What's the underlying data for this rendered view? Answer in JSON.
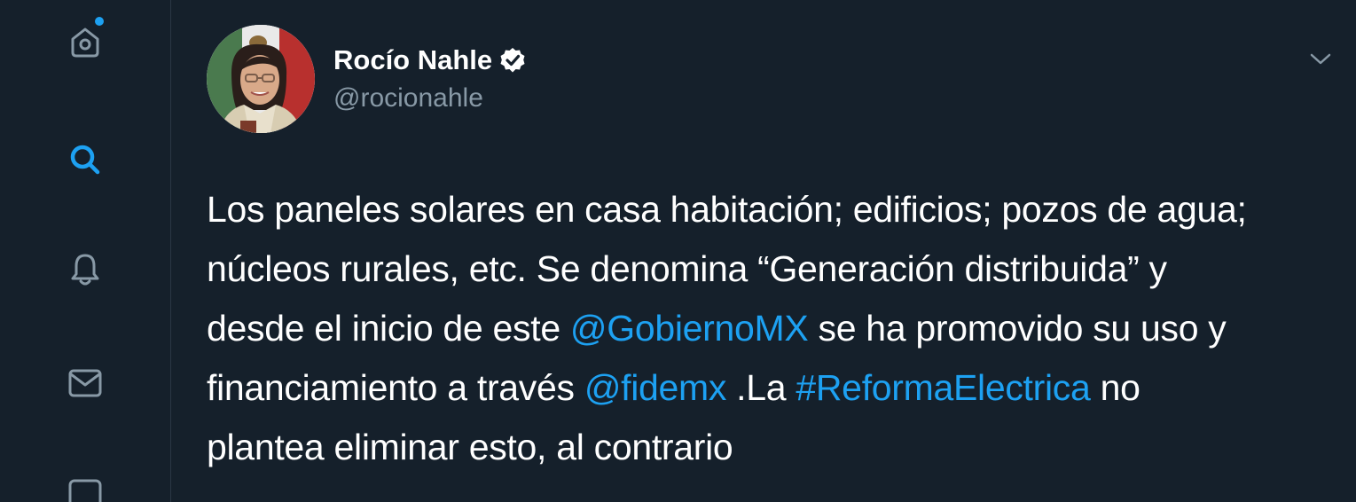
{
  "sidebar": {
    "items": [
      {
        "icon": "home-icon",
        "has_notification_dot": true
      },
      {
        "icon": "search-icon",
        "active": true
      },
      {
        "icon": "bell-icon"
      },
      {
        "icon": "mail-icon"
      },
      {
        "icon": "bookmark-icon"
      }
    ]
  },
  "tweet": {
    "author": {
      "display_name": "Rocío Nahle",
      "handle": "@rocionahle",
      "verified": true
    },
    "text": {
      "l1": "Los paneles solares en casa habitación; edificios; pozos de agua;",
      "l2": "núcleos rurales, etc. Se denomina “Generación distribuida” y",
      "l3_a": "desde el inicio de este ",
      "l3_mention": "@GobiernoMX",
      "l3_b": " se ha promovido su uso y",
      "l4_a": "financiamiento a través ",
      "l4_mention": "@fidemx",
      "l4_b": " .La ",
      "l4_hashtag": "#ReformaElectrica",
      "l4_c": " no",
      "l5": "plantea eliminar esto, al contrario"
    }
  },
  "colors": {
    "background": "#15202b",
    "accent": "#1da1f2",
    "secondary_text": "#8899a6",
    "icon_muted": "#8899a6",
    "divider": "#2a3744"
  }
}
